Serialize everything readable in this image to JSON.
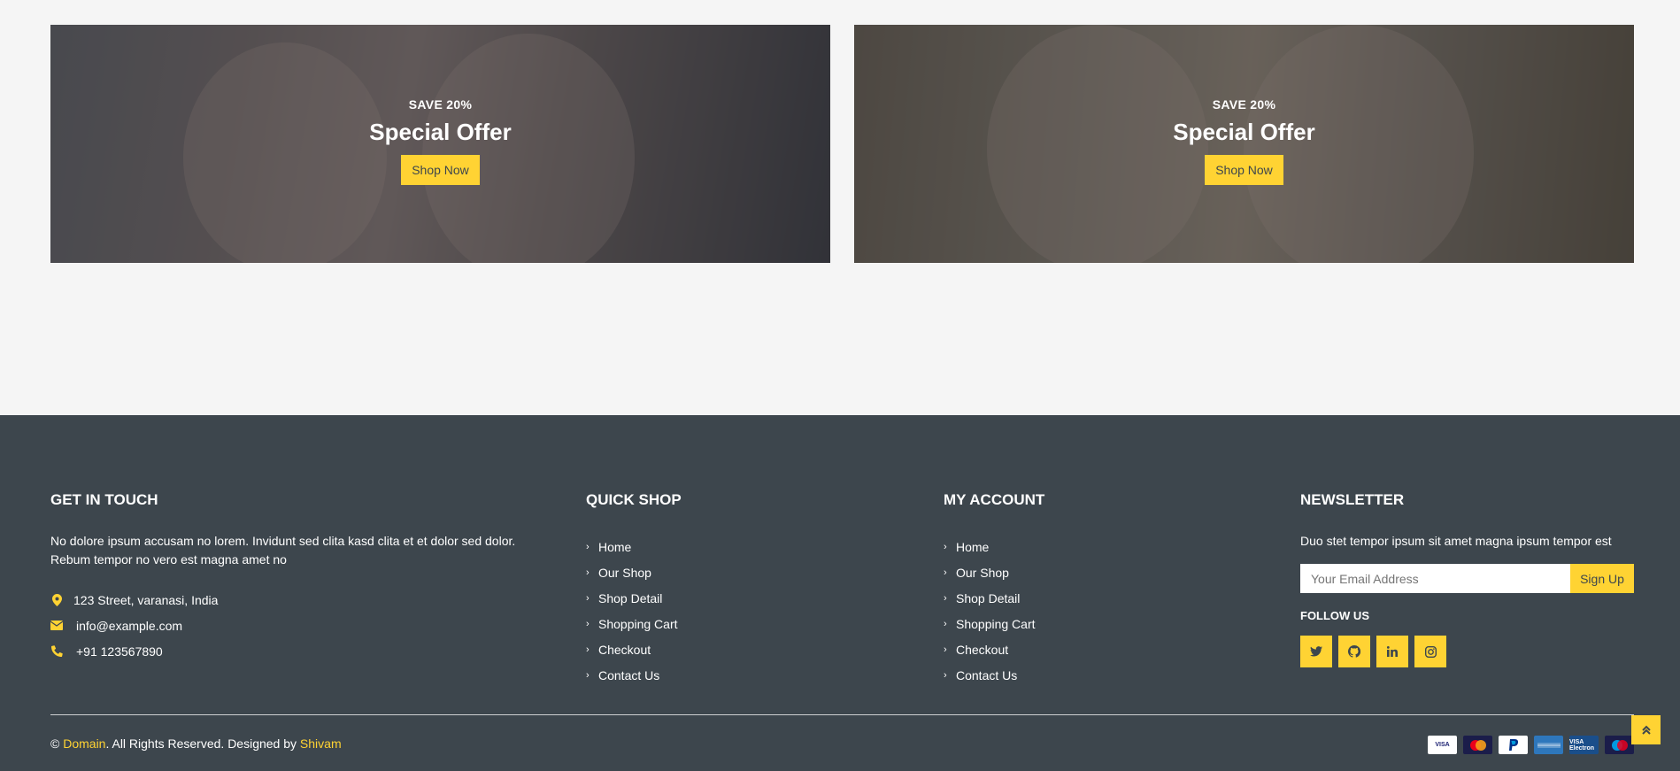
{
  "offers": [
    {
      "subtitle": "SAVE 20%",
      "title": "Special Offer",
      "button": "Shop Now"
    },
    {
      "subtitle": "SAVE 20%",
      "title": "Special Offer",
      "button": "Shop Now"
    }
  ],
  "footer": {
    "get_in_touch": {
      "heading": "GET IN TOUCH",
      "description": "No dolore ipsum accusam no lorem. Invidunt sed clita kasd clita et et dolor sed dolor. Rebum tempor no vero est magna amet no",
      "address": "123 Street, varanasi, India",
      "email": "info@example.com",
      "phone": "+91 123567890"
    },
    "quick_shop": {
      "heading": "QUICK SHOP",
      "links": [
        "Home",
        "Our Shop",
        "Shop Detail",
        "Shopping Cart",
        "Checkout",
        "Contact Us"
      ]
    },
    "my_account": {
      "heading": "MY ACCOUNT",
      "links": [
        "Home",
        "Our Shop",
        "Shop Detail",
        "Shopping Cart",
        "Checkout",
        "Contact Us"
      ]
    },
    "newsletter": {
      "heading": "NEWSLETTER",
      "text": "Duo stet tempor ipsum sit amet magna ipsum tempor est",
      "placeholder": "Your Email Address",
      "button": "Sign Up",
      "follow_heading": "FOLLOW US",
      "socials": [
        "twitter-icon",
        "github-icon",
        "linkedin-icon",
        "instagram-icon"
      ]
    },
    "copyright": {
      "prefix": "© ",
      "domain": "Domain",
      "middle": ". All Rights Reserved. Designed by ",
      "designer": "Shivam"
    },
    "payments": [
      "VISA",
      "MasterCard",
      "PayPal",
      "AMEX",
      "VISA Electron",
      "Maestro"
    ]
  },
  "colors": {
    "accent": "#ffd333",
    "footer_bg": "#3d464d",
    "page_bg": "#f5f5f5"
  }
}
